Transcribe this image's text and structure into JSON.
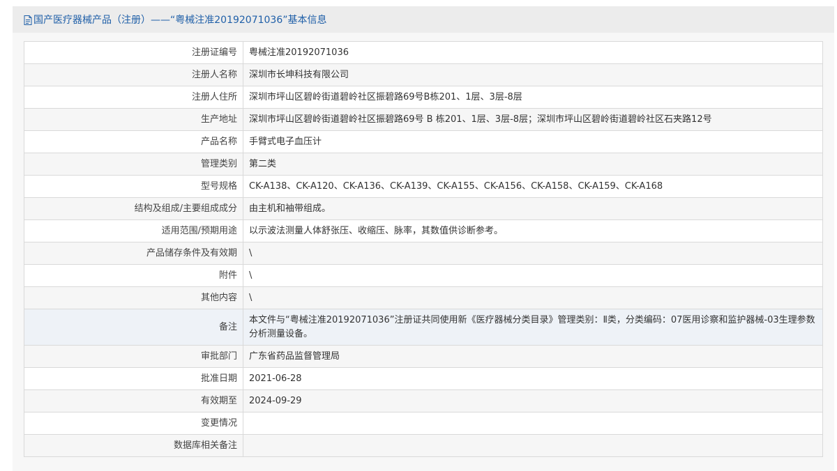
{
  "header": {
    "title": "国产医疗器械产品（注册）——“粤械注准20192071036”基本信息",
    "icon": "document-icon",
    "accent_color": "#1f5fa8"
  },
  "rows": [
    {
      "label": "注册证编号",
      "value": "粤械注准20192071036"
    },
    {
      "label": "注册人名称",
      "value": "深圳市长坤科技有限公司"
    },
    {
      "label": "注册人住所",
      "value": "深圳市坪山区碧岭街道碧岭社区振碧路69号B栋201、1层、3层-8层"
    },
    {
      "label": "生产地址",
      "value": "深圳市坪山区碧岭街道碧岭社区振碧路69号 B 栋201、1层、3层-8层；深圳市坪山区碧岭街道碧岭社区石夹路12号"
    },
    {
      "label": "产品名称",
      "value": "手臂式电子血压计"
    },
    {
      "label": "管理类别",
      "value": "第二类"
    },
    {
      "label": "型号规格",
      "value": "CK-A138、CK-A120、CK-A136、CK-A139、CK-A155、CK-A156、CK-A158、CK-A159、CK-A168"
    },
    {
      "label": "结构及组成/主要组成成分",
      "value": "由主机和袖带组成。"
    },
    {
      "label": "适用范围/预期用途",
      "value": "以示波法测量人体舒张压、收缩压、脉率，其数值供诊断参考。"
    },
    {
      "label": "产品储存条件及有效期",
      "value": "\\"
    },
    {
      "label": "附件",
      "value": "\\"
    },
    {
      "label": "其他内容",
      "value": "\\"
    },
    {
      "label": "备注",
      "value": "本文件与“粤械注准20192071036”注册证共同使用新《医疗器械分类目录》管理类别：Ⅱ类，分类编码：07医用诊察和监护器械-03生理参数分析测量设备。"
    },
    {
      "label": "审批部门",
      "value": "广东省药品监督管理局"
    },
    {
      "label": "批准日期",
      "value": "2021-06-28"
    },
    {
      "label": "有效期至",
      "value": "2024-09-29"
    },
    {
      "label": "变更情况",
      "value": ""
    },
    {
      "label": "数据库相关备注",
      "value": ""
    }
  ]
}
